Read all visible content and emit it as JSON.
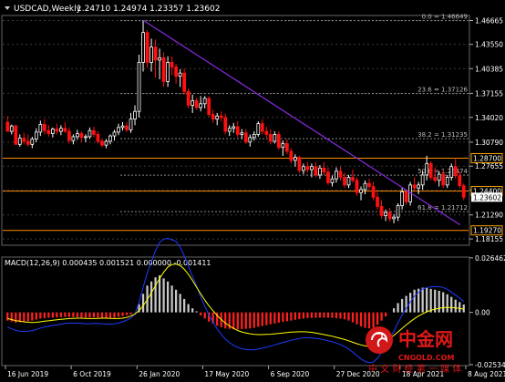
{
  "window": {
    "symbol": "USDCAD,Weekly",
    "ohlc": "1.24710 1.24974 1.23357 1.23602",
    "dropdown_icon": "triangle-down-icon"
  },
  "colors": {
    "background": "#000000",
    "grid": "#444444",
    "candle_up": "#ffffff",
    "candle_down": "#ff0000",
    "level_line": "#ff8c00",
    "fib_line": "#808080",
    "trendline": "#8a2be2",
    "macd_main": "#0000ff",
    "macd_signal": "#ffff00",
    "macd_hist_pos": "#c0c0c0",
    "macd_hist_neg": "#ff0000",
    "axis_text": "#ffffff",
    "highlight_box": "#ffa500",
    "watermark": "#cc0000"
  },
  "chart_data": [
    {
      "type": "candlestick",
      "title": "USDCAD,Weekly",
      "ylim": [
        1.1745,
        1.472
      ],
      "price_axis_labels": [
        "1.46665",
        "1.43550",
        "1.40385",
        "1.37155",
        "1.34020",
        "1.30790",
        "1.27655",
        "1.24500",
        "1.21290",
        "1.18155"
      ],
      "x_tick_labels": [
        "16 Jun 2019",
        "6 Oct 2019",
        "26 Jan 2020",
        "17 May 2020",
        "6 Sep 2020",
        "27 Dec 2020",
        "18 Apr 2021",
        "8 Aug 2021"
      ],
      "fibonacci_levels": [
        {
          "label": "0.0 = 1.46649",
          "value": 1.46649
        },
        {
          "label": "23.6 = 1.37126",
          "value": 1.37126
        },
        {
          "label": "38.2 = 1.31235",
          "value": 1.31235
        },
        {
          "label": "50.0 = 1.26474",
          "value": 1.26474
        },
        {
          "label": "61.8 = 1.21712",
          "value": 1.21712
        }
      ],
      "horizontal_levels": [
        "1.28700",
        "1.24400",
        "1.19270"
      ],
      "current_price": "1.23602",
      "trendline": {
        "from": [
          "26 Jan 2020",
          1.467
        ],
        "to": [
          "8 Aug 2021",
          1.2
        ]
      },
      "candles": [
        [
          1.334,
          1.342,
          1.325,
          1.322
        ],
        [
          1.322,
          1.331,
          1.318,
          1.329
        ],
        [
          1.329,
          1.331,
          1.306,
          1.305
        ],
        [
          1.305,
          1.318,
          1.302,
          1.313
        ],
        [
          1.313,
          1.32,
          1.305,
          1.309
        ],
        [
          1.309,
          1.318,
          1.302,
          1.305
        ],
        [
          1.305,
          1.315,
          1.3,
          1.312
        ],
        [
          1.312,
          1.326,
          1.308,
          1.321
        ],
        [
          1.321,
          1.336,
          1.316,
          1.331
        ],
        [
          1.331,
          1.338,
          1.318,
          1.323
        ],
        [
          1.323,
          1.33,
          1.315,
          1.319
        ],
        [
          1.319,
          1.327,
          1.314,
          1.325
        ],
        [
          1.325,
          1.332,
          1.318,
          1.322
        ],
        [
          1.322,
          1.33,
          1.317,
          1.326
        ],
        [
          1.326,
          1.334,
          1.32,
          1.322
        ],
        [
          1.322,
          1.327,
          1.306,
          1.31
        ],
        [
          1.31,
          1.318,
          1.305,
          1.315
        ],
        [
          1.315,
          1.324,
          1.311,
          1.319
        ],
        [
          1.319,
          1.322,
          1.308,
          1.314
        ],
        [
          1.314,
          1.318,
          1.308,
          1.315
        ],
        [
          1.315,
          1.327,
          1.312,
          1.323
        ],
        [
          1.323,
          1.328,
          1.314,
          1.318
        ],
        [
          1.318,
          1.322,
          1.306,
          1.309
        ],
        [
          1.309,
          1.313,
          1.301,
          1.304
        ],
        [
          1.304,
          1.312,
          1.3,
          1.309
        ],
        [
          1.309,
          1.318,
          1.305,
          1.316
        ],
        [
          1.316,
          1.324,
          1.31,
          1.321
        ],
        [
          1.321,
          1.332,
          1.317,
          1.327
        ],
        [
          1.327,
          1.334,
          1.323,
          1.329
        ],
        [
          1.329,
          1.334,
          1.321,
          1.324
        ],
        [
          1.324,
          1.346,
          1.32,
          1.338
        ],
        [
          1.338,
          1.356,
          1.33,
          1.348
        ],
        [
          1.348,
          1.422,
          1.34,
          1.412
        ],
        [
          1.412,
          1.467,
          1.4,
          1.451
        ],
        [
          1.451,
          1.454,
          1.405,
          1.412
        ],
        [
          1.412,
          1.443,
          1.4,
          1.432
        ],
        [
          1.432,
          1.442,
          1.392,
          1.415
        ],
        [
          1.415,
          1.43,
          1.39,
          1.418
        ],
        [
          1.418,
          1.425,
          1.38,
          1.387
        ],
        [
          1.387,
          1.42,
          1.38,
          1.412
        ],
        [
          1.412,
          1.42,
          1.395,
          1.406
        ],
        [
          1.406,
          1.41,
          1.384,
          1.394
        ],
        [
          1.394,
          1.403,
          1.38,
          1.398
        ],
        [
          1.398,
          1.404,
          1.37,
          1.374
        ],
        [
          1.374,
          1.378,
          1.352,
          1.356
        ],
        [
          1.356,
          1.37,
          1.346,
          1.362
        ],
        [
          1.362,
          1.366,
          1.35,
          1.353
        ],
        [
          1.353,
          1.368,
          1.348,
          1.358
        ],
        [
          1.358,
          1.368,
          1.352,
          1.365
        ],
        [
          1.365,
          1.368,
          1.341,
          1.344
        ],
        [
          1.344,
          1.35,
          1.333,
          1.338
        ],
        [
          1.338,
          1.346,
          1.33,
          1.342
        ],
        [
          1.342,
          1.348,
          1.335,
          1.34
        ],
        [
          1.34,
          1.345,
          1.318,
          1.322
        ],
        [
          1.322,
          1.33,
          1.316,
          1.326
        ],
        [
          1.326,
          1.333,
          1.32,
          1.328
        ],
        [
          1.328,
          1.335,
          1.314,
          1.318
        ],
        [
          1.318,
          1.325,
          1.312,
          1.32
        ],
        [
          1.32,
          1.325,
          1.306,
          1.308
        ],
        [
          1.308,
          1.318,
          1.302,
          1.314
        ],
        [
          1.314,
          1.322,
          1.31,
          1.318
        ],
        [
          1.318,
          1.335,
          1.315,
          1.332
        ],
        [
          1.332,
          1.338,
          1.318,
          1.322
        ],
        [
          1.322,
          1.328,
          1.314,
          1.318
        ],
        [
          1.318,
          1.325,
          1.305,
          1.309
        ],
        [
          1.309,
          1.322,
          1.306,
          1.318
        ],
        [
          1.318,
          1.322,
          1.298,
          1.301
        ],
        [
          1.301,
          1.31,
          1.29,
          1.306
        ],
        [
          1.306,
          1.312,
          1.292,
          1.296
        ],
        [
          1.296,
          1.3,
          1.28,
          1.284
        ],
        [
          1.284,
          1.292,
          1.276,
          1.288
        ],
        [
          1.288,
          1.29,
          1.268,
          1.271
        ],
        [
          1.271,
          1.28,
          1.266,
          1.276
        ],
        [
          1.276,
          1.282,
          1.268,
          1.272
        ],
        [
          1.272,
          1.28,
          1.262,
          1.276
        ],
        [
          1.276,
          1.282,
          1.262,
          1.265
        ],
        [
          1.265,
          1.278,
          1.26,
          1.274
        ],
        [
          1.274,
          1.282,
          1.265,
          1.269
        ],
        [
          1.269,
          1.275,
          1.252,
          1.255
        ],
        [
          1.255,
          1.264,
          1.25,
          1.26
        ],
        [
          1.26,
          1.275,
          1.255,
          1.27
        ],
        [
          1.27,
          1.276,
          1.258,
          1.262
        ],
        [
          1.262,
          1.268,
          1.248,
          1.252
        ],
        [
          1.252,
          1.265,
          1.248,
          1.262
        ],
        [
          1.262,
          1.272,
          1.255,
          1.258
        ],
        [
          1.258,
          1.262,
          1.238,
          1.242
        ],
        [
          1.242,
          1.25,
          1.232,
          1.246
        ],
        [
          1.246,
          1.258,
          1.24,
          1.254
        ],
        [
          1.254,
          1.26,
          1.246,
          1.25
        ],
        [
          1.25,
          1.256,
          1.232,
          1.236
        ],
        [
          1.236,
          1.242,
          1.22,
          1.224
        ],
        [
          1.224,
          1.232,
          1.208,
          1.212
        ],
        [
          1.212,
          1.22,
          1.205,
          1.216
        ],
        [
          1.216,
          1.222,
          1.204,
          1.208
        ],
        [
          1.208,
          1.214,
          1.202,
          1.21
        ],
        [
          1.21,
          1.228,
          1.205,
          1.225
        ],
        [
          1.225,
          1.248,
          1.22,
          1.243
        ],
        [
          1.243,
          1.246,
          1.226,
          1.23
        ],
        [
          1.23,
          1.256,
          1.225,
          1.252
        ],
        [
          1.252,
          1.262,
          1.244,
          1.248
        ],
        [
          1.248,
          1.256,
          1.24,
          1.252
        ],
        [
          1.252,
          1.27,
          1.246,
          1.265
        ],
        [
          1.265,
          1.29,
          1.258,
          1.28
        ],
        [
          1.28,
          1.283,
          1.258,
          1.262
        ],
        [
          1.262,
          1.275,
          1.255,
          1.258
        ],
        [
          1.258,
          1.27,
          1.25,
          1.266
        ],
        [
          1.266,
          1.272,
          1.248,
          1.252
        ],
        [
          1.252,
          1.265,
          1.248,
          1.262
        ],
        [
          1.262,
          1.28,
          1.258,
          1.276
        ],
        [
          1.276,
          1.287,
          1.26,
          1.264
        ],
        [
          1.264,
          1.27,
          1.248,
          1.251
        ],
        [
          1.251,
          1.254,
          1.232,
          1.236
        ]
      ]
    },
    {
      "type": "bar",
      "title": "MACD(12,26,9) 0.000435 0.001521 0.000000 -0.001411",
      "ylim": [
        -0.0254,
        0.0264
      ],
      "axis_labels": [
        "0.026462",
        "0.00",
        "-0.025348"
      ],
      "histogram": [
        -0.004,
        -0.0045,
        -0.005,
        -0.0048,
        -0.0046,
        -0.0044,
        -0.004,
        -0.0035,
        -0.003,
        -0.0028,
        -0.0026,
        -0.0025,
        -0.0024,
        -0.0023,
        -0.0022,
        -0.0022,
        -0.0023,
        -0.0024,
        -0.0025,
        -0.0026,
        -0.0025,
        -0.0024,
        -0.0025,
        -0.0027,
        -0.0029,
        -0.0028,
        -0.0026,
        -0.0022,
        -0.0018,
        -0.0014,
        -0.001,
        0.0,
        0.004,
        0.009,
        0.013,
        0.015,
        0.017,
        0.018,
        0.0165,
        0.015,
        0.013,
        0.011,
        0.009,
        0.0065,
        0.004,
        0.002,
        0.0005,
        -0.0015,
        -0.003,
        -0.0045,
        -0.0055,
        -0.0065,
        -0.0072,
        -0.0078,
        -0.008,
        -0.0082,
        -0.0082,
        -0.0081,
        -0.008,
        -0.0078,
        -0.0075,
        -0.007,
        -0.0066,
        -0.0062,
        -0.0058,
        -0.0054,
        -0.005,
        -0.0046,
        -0.0043,
        -0.004,
        -0.0036,
        -0.0033,
        -0.003,
        -0.0028,
        -0.0027,
        -0.0026,
        -0.0025,
        -0.0025,
        -0.0026,
        -0.0027,
        -0.0028,
        -0.003,
        -0.0034,
        -0.004,
        -0.0048,
        -0.0058,
        -0.0068,
        -0.0075,
        -0.0078,
        -0.0074,
        -0.006,
        -0.004,
        -0.002,
        0.0,
        0.002,
        0.0045,
        0.0065,
        0.008,
        0.0095,
        0.011,
        0.0115,
        0.012,
        0.0118,
        0.0114,
        0.011,
        0.0105,
        0.0098,
        0.0088,
        0.0075,
        0.0062,
        0.005,
        0.0038
      ],
      "signal": [
        -0.003,
        -0.0035,
        -0.004,
        -0.0043,
        -0.0046,
        -0.0048,
        -0.0049,
        -0.0048,
        -0.0046,
        -0.0043,
        -0.0041,
        -0.0038,
        -0.0036,
        -0.0034,
        -0.0032,
        -0.003,
        -0.0029,
        -0.0028,
        -0.0028,
        -0.0029,
        -0.003,
        -0.003,
        -0.0029,
        -0.0028,
        -0.0028,
        -0.0029,
        -0.003,
        -0.003,
        -0.0028,
        -0.0024,
        -0.0018,
        -0.0008,
        0.0008,
        0.0032,
        0.0062,
        0.0096,
        0.013,
        0.0165,
        0.0195,
        0.022,
        0.0232,
        0.0235,
        0.0228,
        0.021,
        0.0185,
        0.0155,
        0.0122,
        0.009,
        0.006,
        0.0032,
        0.0008,
        -0.0015,
        -0.0035,
        -0.0052,
        -0.0066,
        -0.0078,
        -0.0088,
        -0.0095,
        -0.01,
        -0.0104,
        -0.0107,
        -0.0108,
        -0.0108,
        -0.0107,
        -0.0106,
        -0.0104,
        -0.0102,
        -0.01,
        -0.0098,
        -0.0096,
        -0.0095,
        -0.0094,
        -0.0094,
        -0.0095,
        -0.0097,
        -0.01,
        -0.0104,
        -0.0108,
        -0.0112,
        -0.0116,
        -0.0121,
        -0.0126,
        -0.0132,
        -0.0138,
        -0.0145,
        -0.0152,
        -0.0158,
        -0.0163,
        -0.0166,
        -0.0167,
        -0.0163,
        -0.0155,
        -0.0143,
        -0.0128,
        -0.0112,
        -0.0095,
        -0.0078,
        -0.0061,
        -0.0045,
        -0.0031,
        -0.0018,
        -0.0007,
        0.0003,
        0.001,
        0.0016,
        0.002,
        0.0023,
        0.0024,
        0.0024,
        0.0022,
        0.002,
        0.0015
      ],
      "macd": [
        -0.0072,
        -0.008,
        -0.0088,
        -0.0091,
        -0.0092,
        -0.0092,
        -0.0089,
        -0.0083,
        -0.0076,
        -0.0071,
        -0.0067,
        -0.0063,
        -0.006,
        -0.0057,
        -0.0054,
        -0.0052,
        -0.0052,
        -0.0052,
        -0.0053,
        -0.0055,
        -0.0055,
        -0.0054,
        -0.0054,
        -0.0055,
        -0.0057,
        -0.0057,
        -0.0056,
        -0.0052,
        -0.0046,
        -0.0038,
        -0.0028,
        -0.0008,
        0.0048,
        0.0122,
        0.0192,
        0.0246,
        0.03,
        0.034,
        0.0355,
        0.036,
        0.0352,
        0.0345,
        0.0318,
        0.0275,
        0.0225,
        0.0175,
        0.0127,
        0.0075,
        0.003,
        -0.0013,
        -0.0047,
        -0.008,
        -0.0107,
        -0.013,
        -0.0146,
        -0.016,
        -0.017,
        -0.0176,
        -0.018,
        -0.0182,
        -0.0182,
        -0.0178,
        -0.0174,
        -0.0169,
        -0.0164,
        -0.0158,
        -0.0152,
        -0.0146,
        -0.0141,
        -0.0136,
        -0.0131,
        -0.0127,
        -0.0124,
        -0.0123,
        -0.0124,
        -0.0126,
        -0.0129,
        -0.0133,
        -0.0138,
        -0.0143,
        -0.0149,
        -0.0156,
        -0.0166,
        -0.0178,
        -0.0193,
        -0.021,
        -0.0226,
        -0.0238,
        -0.0244,
        -0.0241,
        -0.0223,
        -0.0195,
        -0.0163,
        -0.0128,
        -0.0092,
        -0.005,
        -0.0013,
        0.0019,
        0.005,
        0.0079,
        0.0097,
        0.0113,
        0.0121,
        0.0124,
        0.0126,
        0.0125,
        0.0121,
        0.0112,
        0.0099,
        0.0084,
        0.007,
        0.0053
      ]
    }
  ],
  "watermark": {
    "name_cn": "中金网",
    "domain": "CNGOLD.COM",
    "slogan": "中 文 财 经 第 一 媒 体",
    "logo_icon": "cngold-logo-icon"
  }
}
